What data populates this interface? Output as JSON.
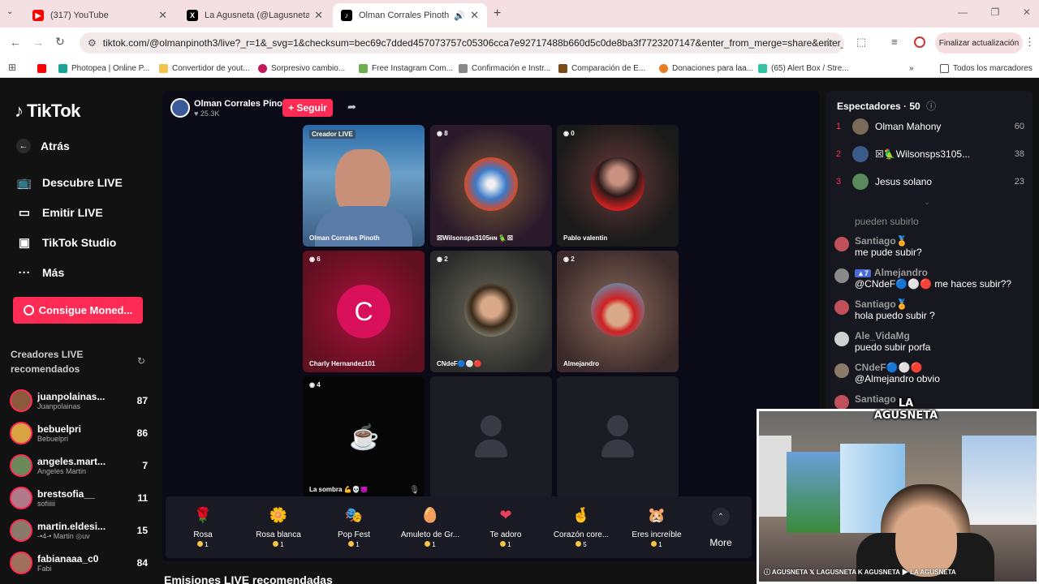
{
  "browser": {
    "tabs": [
      {
        "title": "(317) YouTube",
        "color": "#ff0000",
        "glyph": "▶"
      },
      {
        "title": "La Agusneta (@Lagusneta) / X",
        "color": "#000000",
        "glyph": "X"
      },
      {
        "title": "Olman Corrales Pinoth (@ol",
        "color": "#000000",
        "glyph": "♪"
      }
    ],
    "url": "tiktok.com/@olmanpinoth3/live?_r=1&_svg=1&checksum=bec69c7dded457073757c05306cca7e92717488b660d5c0de8ba3f7723207147&enter_from_merge=share&enter_met...",
    "update_button": "Finalizar actualización",
    "bookmarks": [
      "Photopea | Online P...",
      "Convertidor de yout...",
      "Sorpresivo cambio...",
      "Free Instagram Com...",
      "Confirmación e Instr...",
      "Comparación de E...",
      "Donaciones para laa...",
      "(65) Alert Box / Stre..."
    ],
    "all_bookmarks": "Todos los marcadores"
  },
  "sidebar": {
    "logo": "TikTok",
    "nav": [
      "Atrás",
      "Descubre LIVE",
      "Emitir LIVE",
      "TikTok Studio",
      "Más"
    ],
    "coins_button": "Consigue Moned...",
    "recommended_title": "Creadores LIVE recomendados",
    "creators": [
      {
        "name": "juanpolainas...",
        "sub": "Juanpolainas",
        "count": "87",
        "color": "#8b5a3c"
      },
      {
        "name": "bebuelpri",
        "sub": "Bebuelpri",
        "count": "86",
        "color": "#d9a441"
      },
      {
        "name": "angeles.mart...",
        "sub": "Angeles Martin",
        "count": "7",
        "color": "#6b8a5a"
      },
      {
        "name": "brestsofia__",
        "sub": "sofiiiii",
        "count": "11",
        "color": "#b07a8a"
      },
      {
        "name": "martin.eldesi...",
        "sub": "-•4-• Martin ◎uv",
        "count": "15",
        "color": "#8a7a6a"
      },
      {
        "name": "fabianaaa_c0",
        "sub": "Fabi",
        "count": "84",
        "color": "#a0705a"
      }
    ]
  },
  "host": {
    "name": "Olman Corrales Pinoth",
    "likes": "♥ 25.3K",
    "follow": "+ Seguir"
  },
  "tiles": [
    {
      "label": "Olman Corrales Pinoth",
      "count": "Creador LIVE"
    },
    {
      "label": "☒Wilsonsps3105ʜɴ 🦜☒",
      "count": "8"
    },
    {
      "label": "Pablo valentin",
      "count": "0"
    },
    {
      "label": "Charly Hernandez101",
      "count": "6",
      "initial": "C"
    },
    {
      "label": "CNdeF🔵⚪🔴",
      "count": "2"
    },
    {
      "label": "Almejandro",
      "count": "2"
    },
    {
      "label": "La sombra 💪💀😈",
      "count": "4"
    }
  ],
  "gifts": [
    {
      "name": "Rosa",
      "price": "1",
      "icon": "🌹"
    },
    {
      "name": "Rosa blanca",
      "price": "1",
      "icon": "🌼"
    },
    {
      "name": "Pop Fest",
      "price": "1",
      "icon": "🎭"
    },
    {
      "name": "Amuleto de Gr...",
      "price": "1",
      "icon": "🥚"
    },
    {
      "name": "Te adoro",
      "price": "1",
      "icon": "❤"
    },
    {
      "name": "Corazón core...",
      "price": "5",
      "icon": "🤞"
    },
    {
      "name": "Eres increíble",
      "price": "1",
      "icon": "🐹"
    }
  ],
  "more_label": "More",
  "section_title": "Emisiones LIVE recomendadas",
  "viewers": {
    "title": "Espectadores · 50",
    "list": [
      {
        "rank": "1",
        "name": "Olman Mahony",
        "score": "60",
        "color": "#7a6a5a"
      },
      {
        "rank": "2",
        "name": "☒🦜Wilsonsps3105...",
        "score": "38",
        "color": "#3a5a8a"
      },
      {
        "rank": "3",
        "name": "Jesus solano",
        "score": "23",
        "color": "#5a8a5a"
      }
    ]
  },
  "chat": [
    {
      "user": "",
      "text": "pueden subirlo",
      "color": "#555"
    },
    {
      "user": "Santiago🏅",
      "text": "me pude subir?",
      "color": "#c0505a"
    },
    {
      "user": "Almejandro",
      "text": "@CNdeF🔵⚪🔴 me haces subir??",
      "color": "#8a8a8a",
      "badge": "▲7"
    },
    {
      "user": "Santiago🏅",
      "text": "hola puedo subir ?",
      "color": "#c0505a"
    },
    {
      "user": "Ale_VidaMg",
      "text": "puedo subir porfa",
      "color": "#d0d0d0"
    },
    {
      "user": "CNdeF🔵⚪🔴",
      "text": "@Almejandro obvio",
      "color": "#8a7a6a"
    },
    {
      "user": "Santiago",
      "text": "",
      "color": "#c0505a"
    }
  ],
  "overlay": {
    "logo": "LA AGUSNETA",
    "socials": "ⓘ AGUSNETA  𝕏 LAGUSNETA  K AGUSNETA  ▶ LA AGUSNETA"
  }
}
